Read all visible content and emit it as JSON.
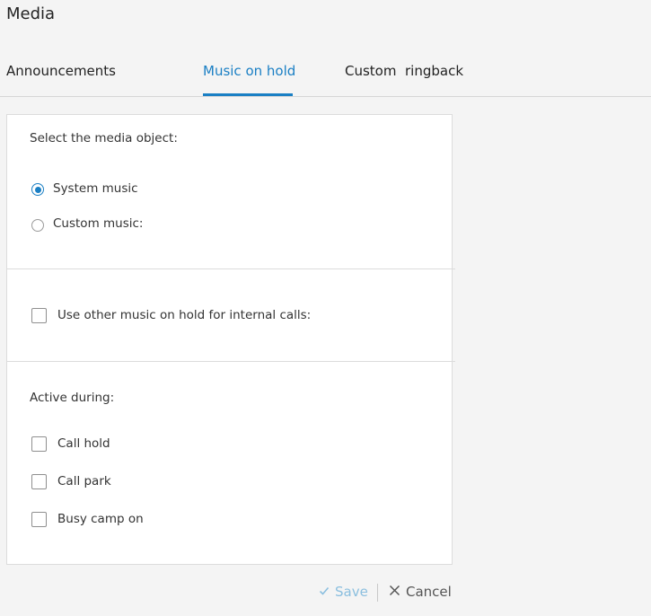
{
  "page": {
    "title": "Media"
  },
  "tabs": [
    {
      "label": "Announcements",
      "active": false
    },
    {
      "label": "Music on hold",
      "active": true
    },
    {
      "label": "Custom  ringback",
      "active": false
    }
  ],
  "media_object": {
    "heading": "Select the media object:",
    "options": [
      {
        "label": "System music",
        "selected": true
      },
      {
        "label": "Custom music:",
        "selected": false
      }
    ]
  },
  "internal_calls": {
    "label": "Use other music on hold for internal calls:",
    "checked": false
  },
  "active_during": {
    "heading": "Active during:",
    "options": [
      {
        "label": "Call hold",
        "checked": false
      },
      {
        "label": "Call park",
        "checked": false
      },
      {
        "label": "Busy camp on",
        "checked": false
      }
    ]
  },
  "footer": {
    "save_label": "Save",
    "cancel_label": "Cancel"
  },
  "colors": {
    "accent": "#1a7fc4",
    "save_disabled": "#8bbfdf",
    "background": "#f4f4f4"
  },
  "icons": {
    "save": "check-icon",
    "cancel": "close-icon"
  }
}
